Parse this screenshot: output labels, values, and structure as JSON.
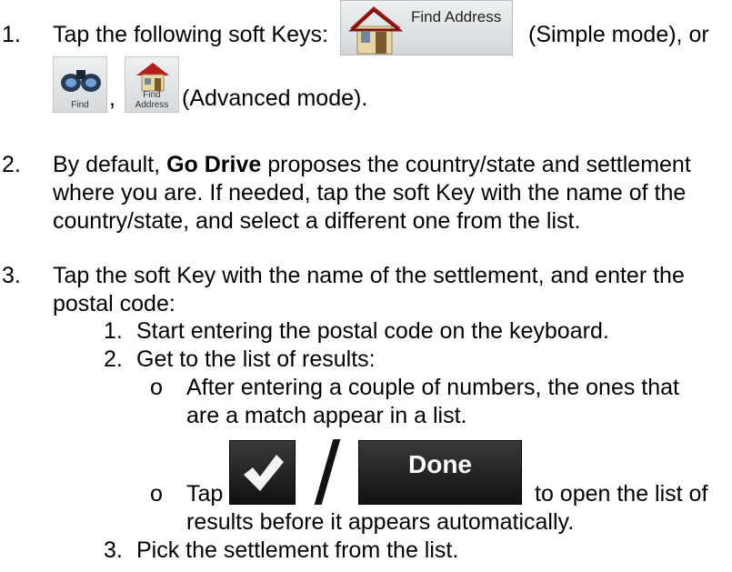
{
  "step1": {
    "num": "1.",
    "prefix": "Tap the following soft Keys:",
    "simple_mode": "(Simple mode), or",
    "comma": ",",
    "advanced_mode": "(Advanced mode).",
    "find_address_key": "Find Address",
    "find_key": "Find",
    "find_address_small_key": "Find Address"
  },
  "step2": {
    "num": "2.",
    "line1_pre": "By default, ",
    "brand": "Go Drive",
    "line1_post": " proposes the country/state and settlement",
    "line2": "where you are. If needed, tap the soft Key with the name of the",
    "line3": "country/state, and select a different one from the list."
  },
  "step3": {
    "num": "3.",
    "line1": "Tap the soft Key with the name of the settlement, and enter the",
    "line2": "postal code:",
    "sub1_num": "1.",
    "sub1": "Start entering the postal code on the keyboard.",
    "sub2_num": "2.",
    "sub2": "Get to the list of results:",
    "bullet_a_mark": "o",
    "bullet_a_line1": "After entering a couple of numbers, the ones that",
    "bullet_a_line2": "are a match appear in a list.",
    "bullet_b_mark": "o",
    "bullet_b_tap": "Tap",
    "bullet_b_post": "to open the list of",
    "bullet_b_line2": "results before it appears automatically.",
    "done_key": "Done",
    "sub3_num": "3.",
    "sub3": "Pick the settlement from the list."
  }
}
